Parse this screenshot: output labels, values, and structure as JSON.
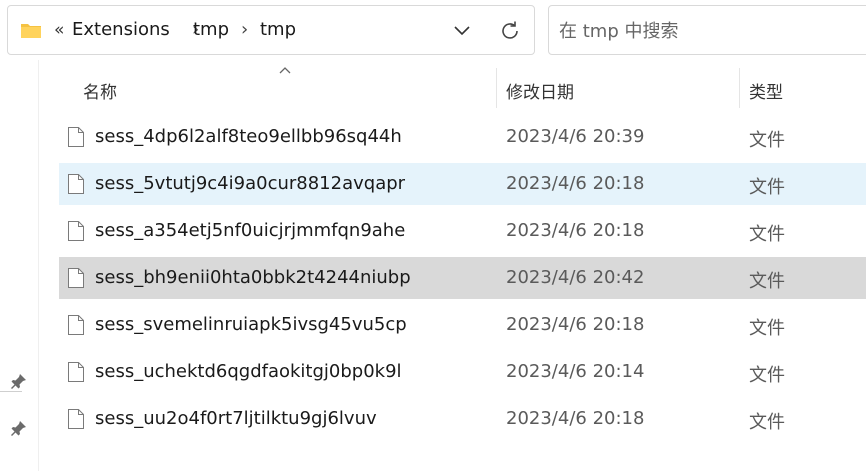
{
  "address_bar": {
    "overflow": "«",
    "breadcrumbs": [
      "Extensions",
      "tmp",
      "tmp"
    ],
    "separator": "›"
  },
  "search": {
    "placeholder": "在 tmp 中搜索",
    "value": ""
  },
  "columns": {
    "name": "名称",
    "date_modified": "修改日期",
    "type": "类型"
  },
  "files": [
    {
      "name": "sess_4dp6l2alf8teo9ellbb96sq44h",
      "date": "2023/4/6 20:39",
      "type": "文件",
      "state": "normal"
    },
    {
      "name": "sess_5vtutj9c4i9a0cur8812avqapr",
      "date": "2023/4/6 20:18",
      "type": "文件",
      "state": "hover"
    },
    {
      "name": "sess_a354etj5nf0uicjrjmmfqn9ahe",
      "date": "2023/4/6 20:18",
      "type": "文件",
      "state": "normal"
    },
    {
      "name": "sess_bh9enii0hta0bbk2t4244niubp",
      "date": "2023/4/6 20:42",
      "type": "文件",
      "state": "selected"
    },
    {
      "name": "sess_svemelinruiapk5ivsg45vu5cp",
      "date": "2023/4/6 20:18",
      "type": "文件",
      "state": "normal"
    },
    {
      "name": "sess_uchektd6qgdfaokitgj0bp0k9l",
      "date": "2023/4/6 20:14",
      "type": "文件",
      "state": "normal"
    },
    {
      "name": "sess_uu2o4f0rt7ljtilktu9gj6lvuv",
      "date": "2023/4/6 20:18",
      "type": "文件",
      "state": "normal"
    }
  ],
  "colors": {
    "hover_row": "#e5f3fb",
    "selected_row": "#d9d9d9",
    "folder_yellow": "#f5c242"
  },
  "icons": {
    "folder": "folder-icon",
    "file": "file-icon",
    "pin": "pin-icon",
    "refresh": "refresh-icon",
    "dropdown": "chevron-down-icon",
    "sort": "sort-ascending-icon"
  }
}
